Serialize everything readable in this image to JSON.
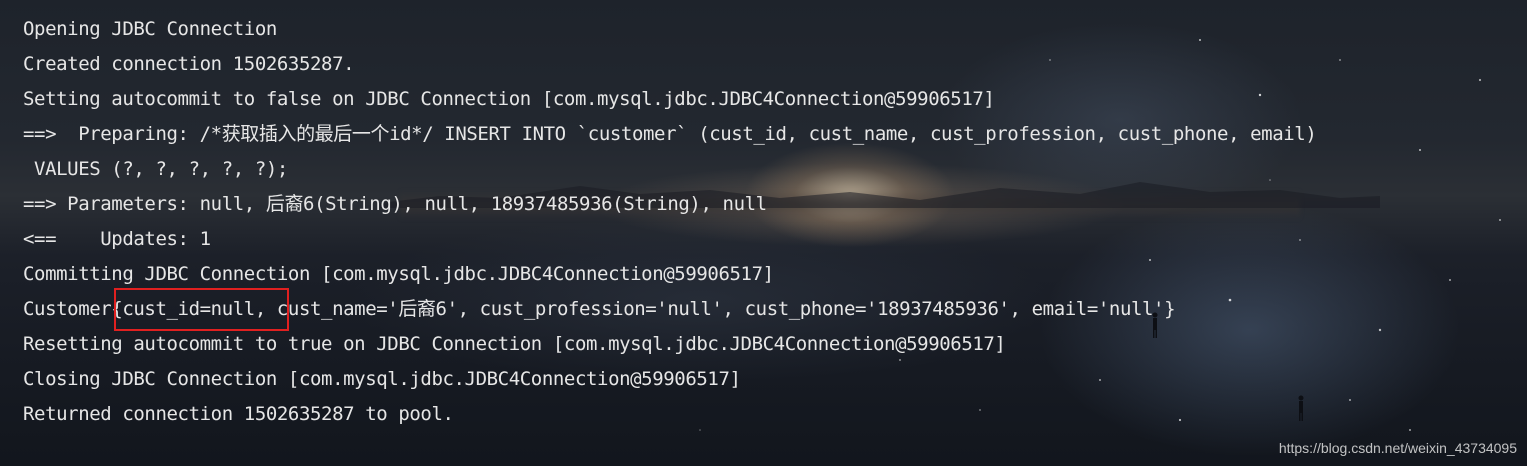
{
  "console": {
    "lines": [
      "Opening JDBC Connection",
      "Created connection 1502635287.",
      "Setting autocommit to false on JDBC Connection [com.mysql.jdbc.JDBC4Connection@59906517]",
      "==>  Preparing: /*获取插入的最后一个id*/ INSERT INTO `customer` (cust_id, cust_name, cust_profession, cust_phone, email)",
      " VALUES (?, ?, ?, ?, ?);",
      "==> Parameters: null, 后裔6(String), null, 18937485936(String), null",
      "<==    Updates: 1",
      "Committing JDBC Connection [com.mysql.jdbc.JDBC4Connection@59906517]",
      "Customer{cust_id=null, cust_name='后裔6', cust_profession='null', cust_phone='18937485936', email='null'}",
      "Resetting autocommit to true on JDBC Connection [com.mysql.jdbc.JDBC4Connection@59906517]",
      "Closing JDBC Connection [com.mysql.jdbc.JDBC4Connection@59906517]",
      "Returned connection 1502635287 to pool."
    ]
  },
  "watermark": "https://blog.csdn.net/weixin_43734095",
  "colors": {
    "text": "#e6e6e6",
    "highlight_border": "#e02020"
  }
}
